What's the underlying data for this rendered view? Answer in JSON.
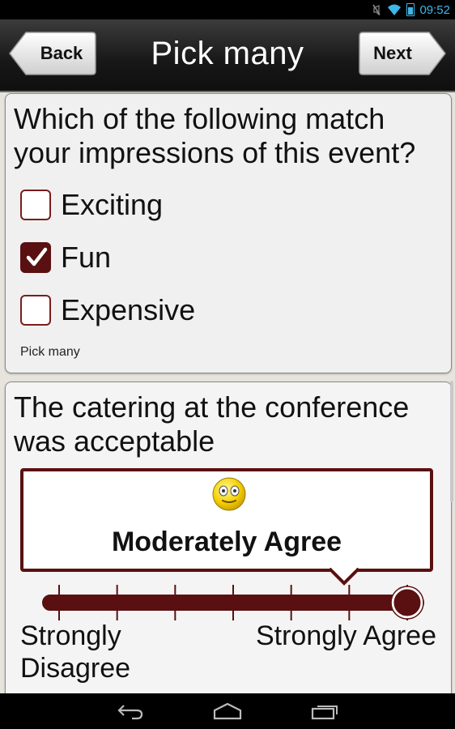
{
  "status_bar": {
    "time": "09:52",
    "icons": [
      "mute-icon",
      "wifi-icon",
      "battery-icon"
    ],
    "accent": "#3fb6e8"
  },
  "header": {
    "title": "Pick many",
    "back_label": "Back",
    "next_label": "Next"
  },
  "question1": {
    "text": "Which of the following match your impressions of this event?",
    "options": [
      {
        "label": "Exciting",
        "checked": false
      },
      {
        "label": "Fun",
        "checked": true
      },
      {
        "label": "Expensive",
        "checked": false
      }
    ],
    "hint": "Pick many"
  },
  "question2": {
    "text": "The catering at the conference was acceptable",
    "emoji": "surprised-face-icon",
    "rating_label": "Moderately Agree",
    "scale_min_label": "Strongly Disagree",
    "scale_max_label": "Strongly Agree",
    "steps": 7,
    "selected_step": 6
  },
  "nav_bar": {
    "icons": [
      "back-icon",
      "home-icon",
      "recents-icon"
    ]
  },
  "colors": {
    "brand": "#5a1010",
    "card_bg": "#f0f0f0",
    "header_bg": "#171717"
  }
}
